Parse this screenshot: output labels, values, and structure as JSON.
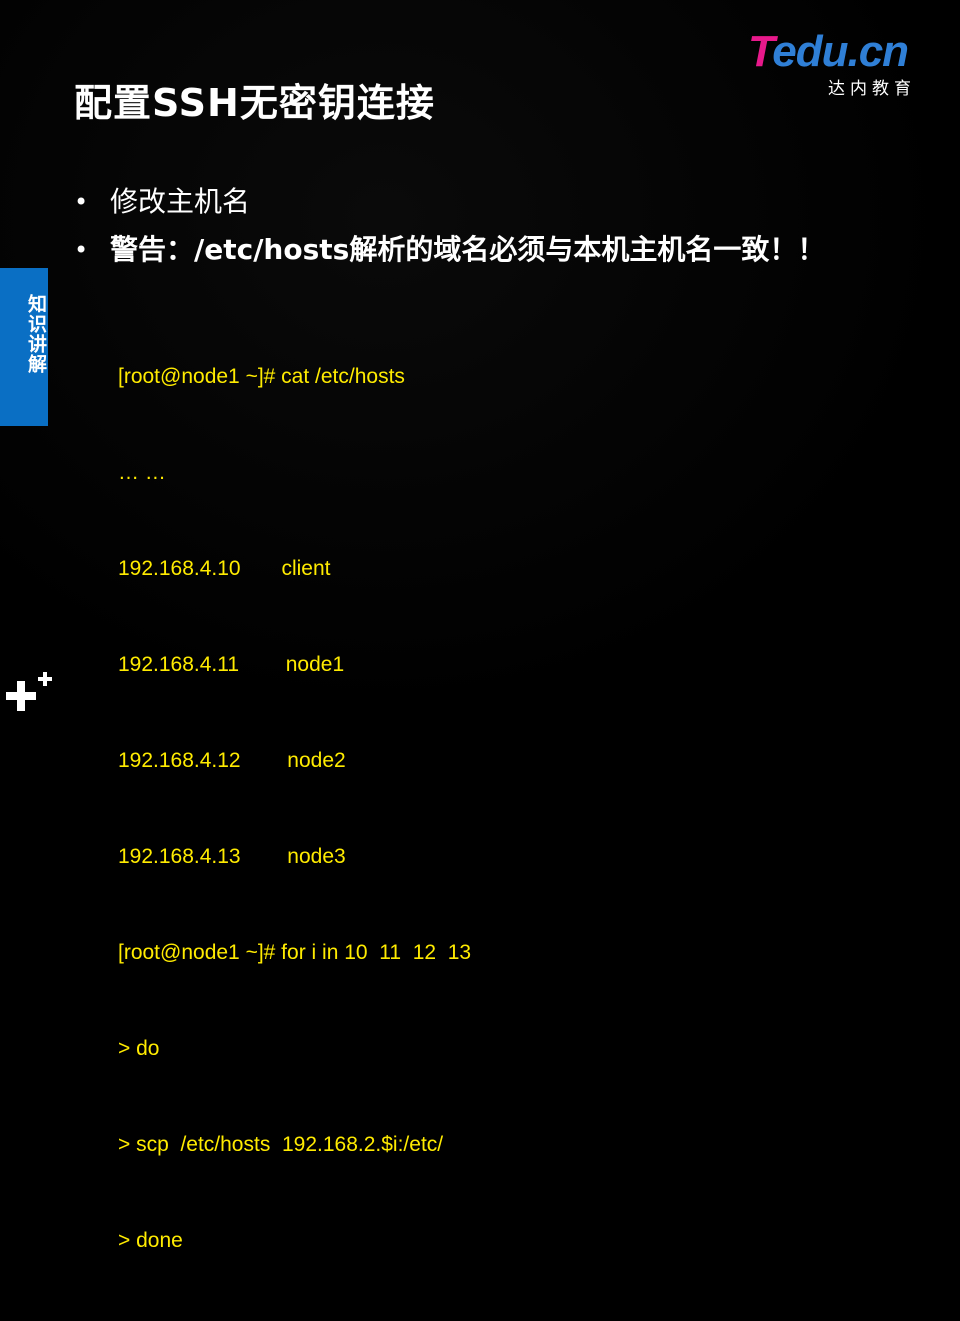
{
  "title": "配置SSH无密钥连接",
  "logo": {
    "letters": [
      "T",
      "edu",
      ".cn"
    ],
    "subtitle": "达内教育"
  },
  "side_tab": {
    "label": "知识讲解"
  },
  "bullets": [
    {
      "text": "修改主机名",
      "bold": false
    },
    {
      "text": "警告：/etc/hosts解析的域名必须与本机主机名一致！！",
      "bold": true
    }
  ],
  "code_lines": [
    "[root@node1 ~]# cat /etc/hosts",
    "… …",
    "192.168.4.10       client",
    "192.168.4.11        node1",
    "192.168.4.12        node2",
    "192.168.4.13        node3",
    "[root@node1 ~]# for i in 10  11  12  13",
    "> do",
    "> scp  /etc/hosts  192.168.2.$i:/etc/",
    "> done"
  ],
  "colors": {
    "background": "#000000",
    "code": "#ffeb00",
    "side_tab": "#0a6fc4",
    "logo_magenta": "#e8198b",
    "logo_blue": "#2f7fd6"
  },
  "icons": {
    "bullet": "bullet-dot-icon",
    "corner": "plus-decoration-icon"
  }
}
